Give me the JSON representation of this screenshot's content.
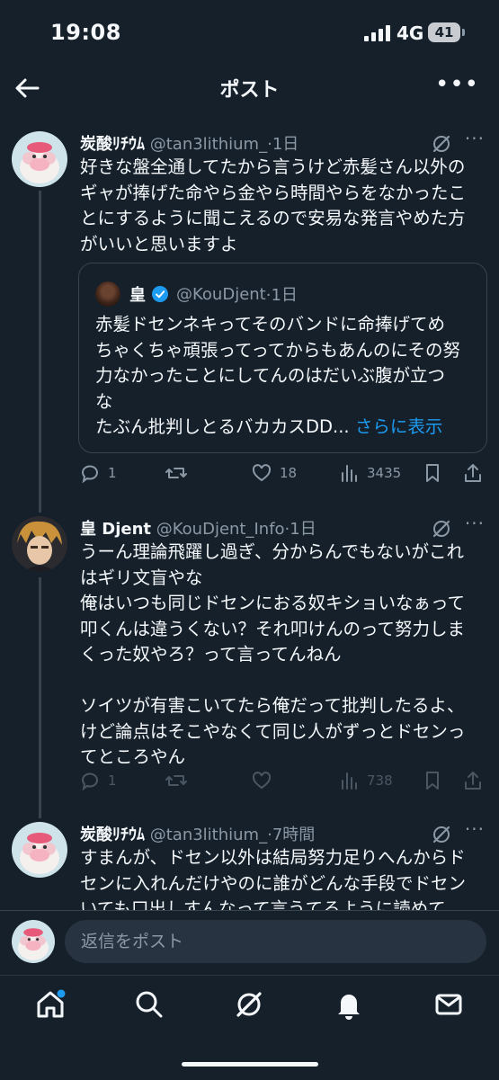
{
  "status_bar": {
    "time": "19:08",
    "network": "4G",
    "battery": "41"
  },
  "header": {
    "title": "ポスト"
  },
  "tweets": [
    {
      "name": "炭酸ﾘﾁｳﾑ",
      "handle": "@tan3lithium_",
      "time": "·1日",
      "text": "好きな盤全通してたから言うけど赤髪さん以外の\nギャが捧げた命やら金やら時間やらをなかったこ\nとにするように聞こえるので安易な発言やめた方\nがいいと思いますよ",
      "quote": {
        "name": "皇",
        "handle": "@KouDjent",
        "time": "·1日",
        "text": "赤髪ドセンネキってそのバンドに命捧げてめ\nちゃくちゃ頑張ってってからもあんのにその努\n力なかったことにしてんのはだいぶ腹が立つ\nな\nたぶん批判しとるバカカスDD... ",
        "show_more": "さらに表示"
      },
      "replies": "1",
      "retweets": "",
      "likes": "18",
      "views": "3435"
    },
    {
      "name": "皇 Djent",
      "handle": "@KouDjent_Info",
      "time": "·1日",
      "text": "うーん理論飛躍し過ぎ、分からんでもないがこれ\nはギリ文盲やな\n俺はいつも同じドセンにおる奴キショいなぁって\n叩くんは違うくない？それ叩けんのって努力しま\nくった奴やろ？って言ってんねん\n\nソイツが有害こいてたら俺だって批判したるよ、\nけど論点はそこやなくて同じ人がずっとドセンっ\nてところやん",
      "replies": "1",
      "retweets": "",
      "likes": "",
      "views": "738"
    },
    {
      "name": "炭酸ﾘﾁｳﾑ",
      "handle": "@tan3lithium_",
      "time": "·7時間",
      "text": "すまんが、ドセン以外は結局努力足りへんからド\nセンに入れんだけやのに誰がどんな手段でドセン\nいても口出しすんなって言うてるように読めて"
    }
  ],
  "reply_bar": {
    "placeholder": "返信をポスト"
  },
  "colors": {
    "background": "#15202b",
    "accent": "#1d9bf0",
    "muted": "#8b98a5",
    "border": "#38444d"
  },
  "icons": [
    "back-arrow-icon",
    "more-icon",
    "grok-icon",
    "reply-icon",
    "retweet-icon",
    "like-icon",
    "views-icon",
    "bookmark-icon",
    "share-icon",
    "home-icon",
    "search-icon",
    "grok-tab-icon",
    "notifications-icon",
    "messages-icon"
  ]
}
